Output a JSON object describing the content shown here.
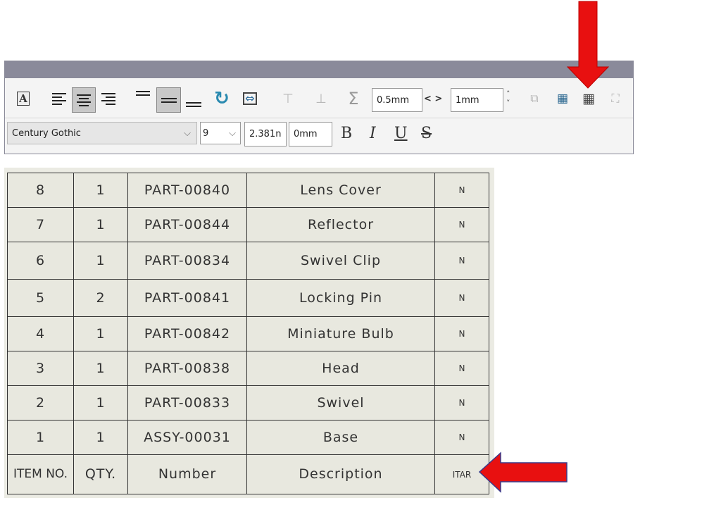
{
  "toolbar": {
    "row1": {
      "spacing_value": "0.5mm",
      "spacing_arrows": "< >",
      "gap_value": "1mm",
      "sigma": "Σ"
    },
    "row2": {
      "font": "Century Gothic",
      "font_size": "9",
      "height_value": "2.381n",
      "offset_value": "0mm",
      "bold": "B",
      "italic": "I",
      "underline": "U",
      "strike": "S"
    },
    "icons": [
      "text-format-icon",
      "align-left-icon",
      "align-center-icon",
      "align-right-icon",
      "valign-top-icon",
      "valign-middle-icon",
      "valign-bottom-icon",
      "rotate-icon",
      "fit-width-icon",
      "insert-below-icon",
      "insert-above-icon",
      "sum-icon",
      "copy-format-icon",
      "table-view-icon",
      "table-icon",
      "select-icon"
    ]
  },
  "table": {
    "header": [
      "ITEM NO.",
      "QTY.",
      "Number",
      "Description",
      "ITAR"
    ],
    "rows": [
      [
        "8",
        "1",
        "PART-00840",
        "Lens Cover",
        "N"
      ],
      [
        "7",
        "1",
        "PART-00844",
        "Reflector",
        "N"
      ],
      [
        "6",
        "1",
        "PART-00834",
        "Swivel Clip",
        "N"
      ],
      [
        "5",
        "2",
        "PART-00841",
        "Locking Pin",
        "N"
      ],
      [
        "4",
        "1",
        "PART-00842",
        "Miniature Bulb",
        "N"
      ],
      [
        "3",
        "1",
        "PART-00838",
        "Head",
        "N"
      ],
      [
        "2",
        "1",
        "PART-00833",
        "Swivel",
        "N"
      ],
      [
        "1",
        "1",
        "ASSY-00031",
        "Base",
        "N"
      ]
    ]
  },
  "colors": {
    "annotation_arrow": "#e81010",
    "titlebar": "#8a8a9a",
    "table_bg": "#e8e8df"
  }
}
